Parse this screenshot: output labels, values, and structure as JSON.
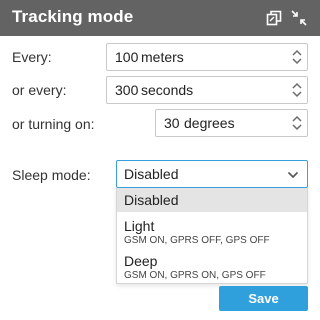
{
  "header": {
    "title": "Tracking mode",
    "icons": [
      "copy-icon",
      "collapse-icon"
    ]
  },
  "fields": {
    "every": {
      "label": "Every:",
      "value": "100",
      "unit": "meters"
    },
    "or_every": {
      "label": "or every:",
      "value": "300",
      "unit": "seconds"
    },
    "turning": {
      "label": "or turning on:",
      "value": "30",
      "unit": "degrees"
    }
  },
  "sleep_mode": {
    "label": "Sleep mode:",
    "selected": "Disabled",
    "options": [
      {
        "label": "Disabled",
        "detail": ""
      },
      {
        "label": "Light",
        "detail": "GSM ON, GPRS OFF, GPS OFF"
      },
      {
        "label": "Deep",
        "detail": "GSM ON, GPRS ON, GPS OFF"
      }
    ]
  },
  "footer": {
    "save_label": "Save"
  },
  "colors": {
    "header_bg": "#636363",
    "accent": "#2fa0dc",
    "selected_option_bg": "#e4e4e4"
  }
}
